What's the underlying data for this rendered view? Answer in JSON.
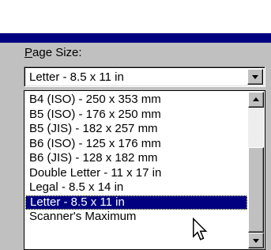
{
  "page_size": {
    "label_accel": "P",
    "label_rest": "age Size:",
    "selected_value": "Letter - 8.5 x 11 in",
    "options": [
      "B4 (ISO) - 250 x 353 mm",
      "B5 (ISO) - 176 x 250 mm",
      "B5 (JIS) - 182 x 257 mm",
      "B6 (ISO) - 125 x 176 mm",
      "B6 (JIS) - 128 x 182 mm",
      "Double Letter - 11 x 17 in",
      "Legal - 8.5 x 14 in",
      "Letter - 8.5 x 11 in",
      "Scanner's Maximum"
    ],
    "highlighted_index": 7
  },
  "colors": {
    "selection": "#000080",
    "title_band": "#000080",
    "face": "#c0c0c0"
  },
  "icons": {
    "dropdown": "triangle-down",
    "scroll_up": "triangle-up",
    "scroll_down": "triangle-down",
    "pointer": "arrow-cursor"
  }
}
